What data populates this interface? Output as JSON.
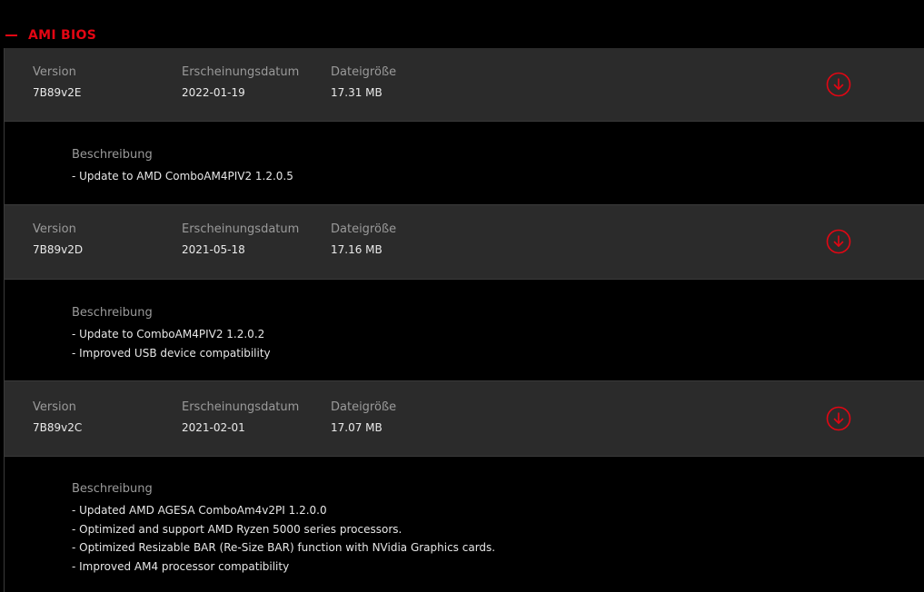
{
  "section": {
    "title": "AMI BIOS",
    "accent": "#e30613"
  },
  "labels": {
    "version": "Version",
    "date": "Erscheinungsdatum",
    "size": "Dateigröße",
    "description": "Beschreibung"
  },
  "entries": [
    {
      "version": "7B89v2E",
      "date": "2022-01-19",
      "size": "17.31 MB",
      "download_icon": "download-circle-icon",
      "description": [
        "- Update to AMD ComboAM4PIV2 1.2.0.5"
      ]
    },
    {
      "version": "7B89v2D",
      "date": "2021-05-18",
      "size": "17.16 MB",
      "download_icon": "download-circle-icon",
      "description": [
        "- Update to ComboAM4PIV2 1.2.0.2",
        "- Improved USB device compatibility"
      ]
    },
    {
      "version": "7B89v2C",
      "date": "2021-02-01",
      "size": "17.07 MB",
      "download_icon": "download-circle-icon",
      "description": [
        "- Updated AMD AGESA ComboAm4v2PI 1.2.0.0",
        "- Optimized and support AMD Ryzen 5000 series processors.",
        "- Optimized Resizable BAR (Re-Size BAR) function with NVidia Graphics cards.",
        "- Improved AM4 processor compatibility"
      ]
    }
  ]
}
